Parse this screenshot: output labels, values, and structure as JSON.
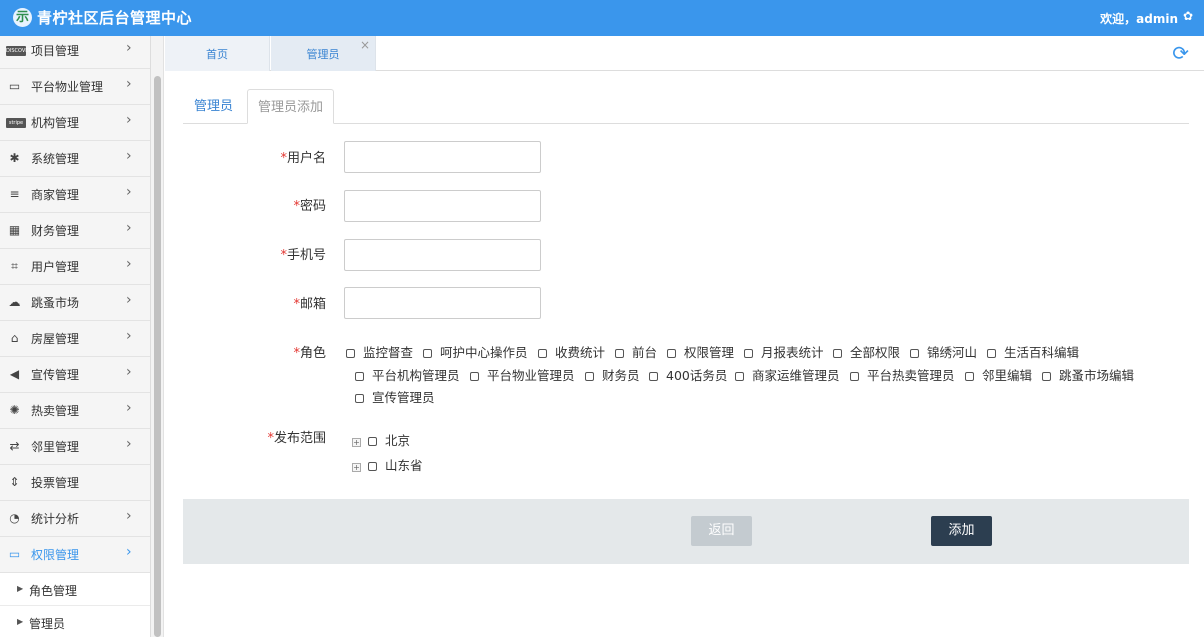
{
  "header": {
    "title": "青柠社区后台管理中心",
    "logo_glyph": "示",
    "welcome": "欢迎，admin",
    "gear_glyph": "✿"
  },
  "sidebar": {
    "items": [
      {
        "label": "项目管理",
        "icon": "discover-card-icon"
      },
      {
        "label": "平台物业管理",
        "icon": "monitor-icon"
      },
      {
        "label": "机构管理",
        "icon": "stripe-icon"
      },
      {
        "label": "系统管理",
        "icon": "yelp-icon"
      },
      {
        "label": "商家管理",
        "icon": "list-icon"
      },
      {
        "label": "财务管理",
        "icon": "calculator-icon"
      },
      {
        "label": "用户管理",
        "icon": "crop-icon"
      },
      {
        "label": "跳蚤市场",
        "icon": "cloud-icon"
      },
      {
        "label": "房屋管理",
        "icon": "bank-icon"
      },
      {
        "label": "宣传管理",
        "icon": "volume-icon"
      },
      {
        "label": "热卖管理",
        "icon": "sun-icon"
      },
      {
        "label": "邻里管理",
        "icon": "retweet-icon"
      },
      {
        "label": "投票管理",
        "icon": "sort-icon"
      },
      {
        "label": "统计分析",
        "icon": "pie-chart-icon"
      },
      {
        "label": "权限管理",
        "icon": "desktop-icon"
      }
    ],
    "subitems": [
      {
        "label": "角色管理"
      },
      {
        "label": "管理员"
      }
    ],
    "badge_text": {
      "discover": "DISCOVER",
      "stripe": "stripe"
    }
  },
  "tabs": {
    "home": "首页",
    "admin": "管理员",
    "close": "×"
  },
  "subtabs": {
    "list": "管理员",
    "add": "管理员添加"
  },
  "form": {
    "required_mark": "*",
    "username_label": "用户名",
    "password_label": "密码",
    "phone_label": "手机号",
    "email_label": "邮箱",
    "role_label": "角色",
    "scope_label": "发布范围",
    "roles": [
      "监控督查",
      "呵护中心操作员",
      "收费统计",
      "前台",
      "权限管理",
      "月报表统计",
      "全部权限",
      "锦绣河山",
      "生活百科编辑",
      "平台机构管理员",
      "平台物业管理员",
      "财务员",
      "400话务员",
      "商家运维管理员",
      "平台热卖管理员",
      "邻里编辑",
      "跳蚤市场编辑",
      "宣传管理员"
    ],
    "scope": [
      "北京",
      "山东省"
    ]
  },
  "actions": {
    "back": "返回",
    "add": "添加"
  },
  "colors": {
    "header_bg": "#3a96ec",
    "accent": "#3a84d2",
    "required": "#e3342f",
    "add_button": "#2c3e50",
    "back_button": "#c4cbd0"
  }
}
